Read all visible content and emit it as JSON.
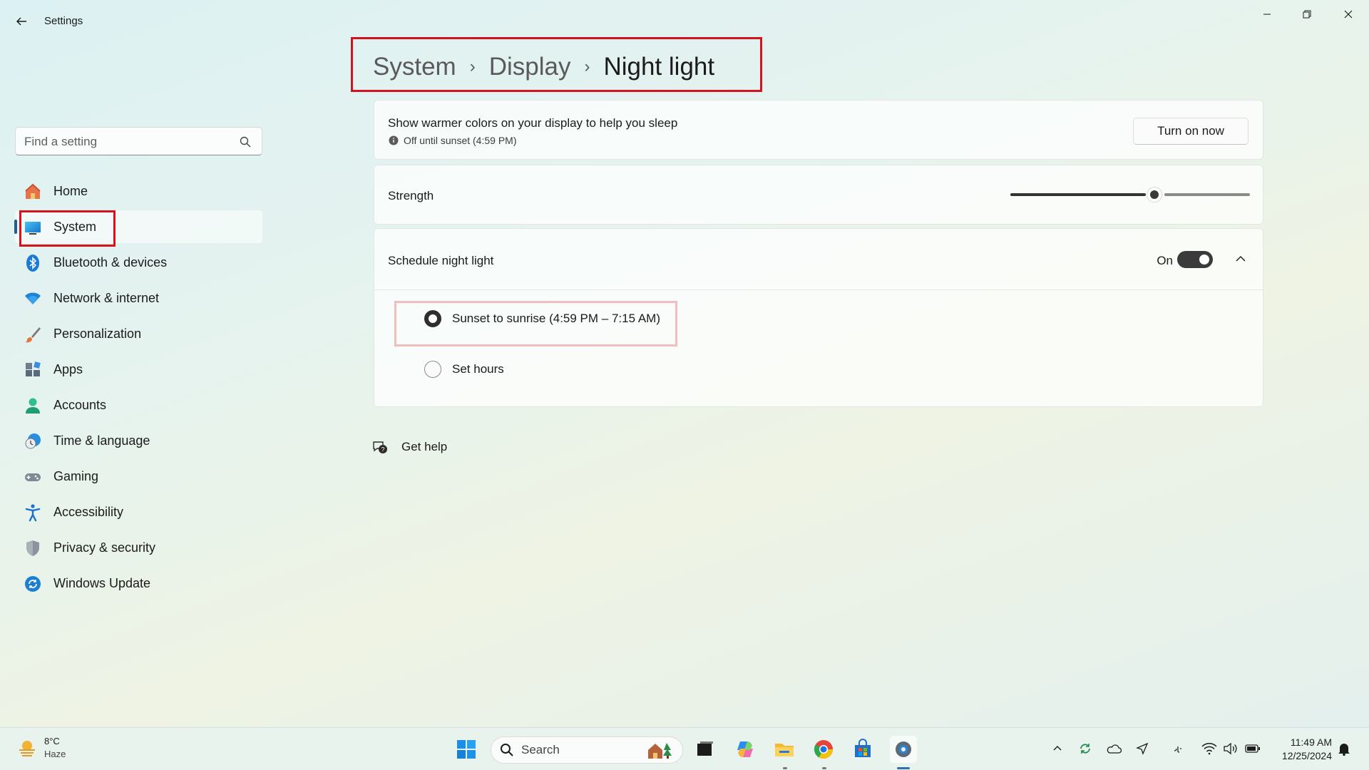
{
  "window": {
    "title": "Settings"
  },
  "sidebar": {
    "search_placeholder": "Find a setting",
    "items": [
      {
        "label": "Home",
        "icon": "home-icon"
      },
      {
        "label": "System",
        "icon": "system-icon",
        "selected": true
      },
      {
        "label": "Bluetooth & devices",
        "icon": "bluetooth-icon"
      },
      {
        "label": "Network & internet",
        "icon": "wifi-icon"
      },
      {
        "label": "Personalization",
        "icon": "brush-icon"
      },
      {
        "label": "Apps",
        "icon": "apps-icon"
      },
      {
        "label": "Accounts",
        "icon": "accounts-icon"
      },
      {
        "label": "Time & language",
        "icon": "time-language-icon"
      },
      {
        "label": "Gaming",
        "icon": "gaming-icon"
      },
      {
        "label": "Accessibility",
        "icon": "accessibility-icon"
      },
      {
        "label": "Privacy & security",
        "icon": "shield-icon"
      },
      {
        "label": "Windows Update",
        "icon": "update-icon"
      }
    ]
  },
  "breadcrumb": {
    "parts": [
      "System",
      "Display"
    ],
    "current": "Night light",
    "separator": "›"
  },
  "night_light": {
    "description": "Show warmer colors on your display to help you sleep",
    "status": "Off until sunset (4:59 PM)",
    "turn_on_label": "Turn on now",
    "strength_label": "Strength",
    "strength_value": 0.6,
    "schedule_label": "Schedule night light",
    "schedule_state": "On",
    "schedule_enabled": true,
    "options": [
      {
        "label": "Sunset to sunrise (4:59 PM – 7:15 AM)",
        "checked": true
      },
      {
        "label": "Set hours",
        "checked": false
      }
    ]
  },
  "help": {
    "label": "Get help"
  },
  "taskbar": {
    "weather_temp": "8°C",
    "weather_desc": "Haze",
    "search_label": "Search",
    "time": "11:49 AM",
    "date": "12/25/2024"
  },
  "colors": {
    "highlight": "#d3141f",
    "accent": "#2a5a86"
  }
}
